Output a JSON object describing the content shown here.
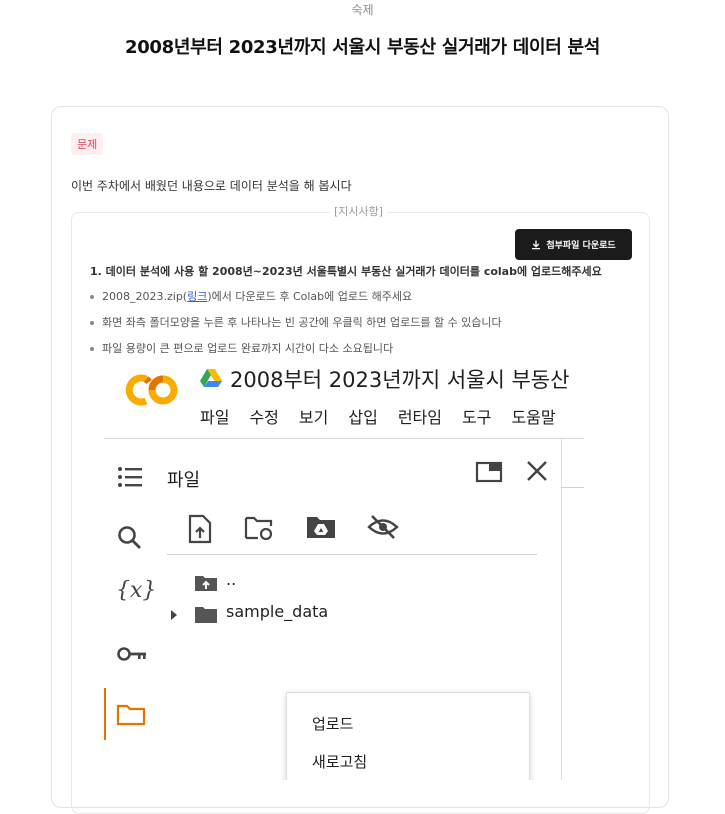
{
  "header": {
    "label": "숙제",
    "title": "2008년부터 2023년까지 서울시 부동산 실거래가 데이터 분석"
  },
  "card": {
    "badge": "문제",
    "question": "이번 주차에서 배웠던 내용으로 데이터 분석을 해 봅시다",
    "instructions_tag": "[지시사항]",
    "download_button": "첨부파일 다운로드",
    "step1": "1. 데이터 분석에 사용 할 2008년~2023년 서울특별시 부동산 실거래가 데이터를 colab에 업로드해주세요",
    "bullets": [
      {
        "before": "2008_2023.zip(",
        "link": "링크",
        "after": ")에서 다운로드 후 Colab에 업로드 해주세요"
      },
      {
        "text": "화면 좌측 폴더모양을 누른 후 나타나는 빈 공간에 우클릭 하면 업로드를 할 수 있습니다"
      },
      {
        "text": "파일 용량이 큰 편으로 업로드 완료까지 시간이 다소 소요됩니다"
      }
    ]
  },
  "colab": {
    "logo": "CO",
    "notebook_title": "2008부터 2023년까지 서울시 부동산",
    "menu": [
      "파일",
      "수정",
      "보기",
      "삽입",
      "런타임",
      "도구",
      "도움말"
    ],
    "sidebar_icons": [
      "toc-icon",
      "search-icon",
      "variables-icon",
      "key-icon",
      "folder-icon"
    ],
    "variables_glyph": "{x}",
    "panel_title": "파일",
    "tree": [
      {
        "name": "..",
        "icon": "folder-up-icon"
      },
      {
        "name": "sample_data",
        "icon": "folder-icon"
      }
    ],
    "context_menu": [
      "업로드",
      "새로고침"
    ]
  },
  "colors": {
    "badge_bg": "#fdeef0",
    "badge_text": "#e2425a",
    "button_bg": "#1b1b1b",
    "colab_orange": "#f9ab00",
    "colab_orange_dark": "#e37400",
    "link": "#2b63d6"
  }
}
